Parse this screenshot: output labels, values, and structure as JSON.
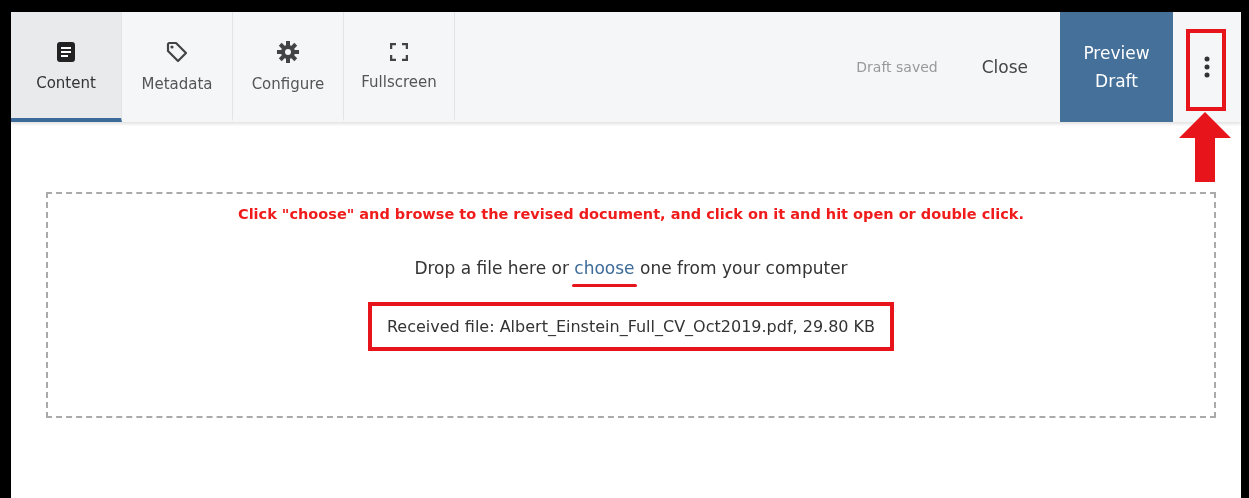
{
  "tabs": [
    {
      "label": "Content",
      "selected": true
    },
    {
      "label": "Metadata",
      "selected": false
    },
    {
      "label": "Configure",
      "selected": false
    },
    {
      "label": "Fullscreen",
      "selected": false
    }
  ],
  "status": "Draft saved",
  "close": "Close",
  "preview": "Preview Draft",
  "instruction": "Click \"choose\" and browse to the revised document, and click on it and hit open or double click.",
  "drop": {
    "before": "Drop a file here or",
    "link": "choose",
    "after": "one from your computer"
  },
  "received": "Received file: Albert_Einstein_Full_CV_Oct2019.pdf, 29.80 KB"
}
